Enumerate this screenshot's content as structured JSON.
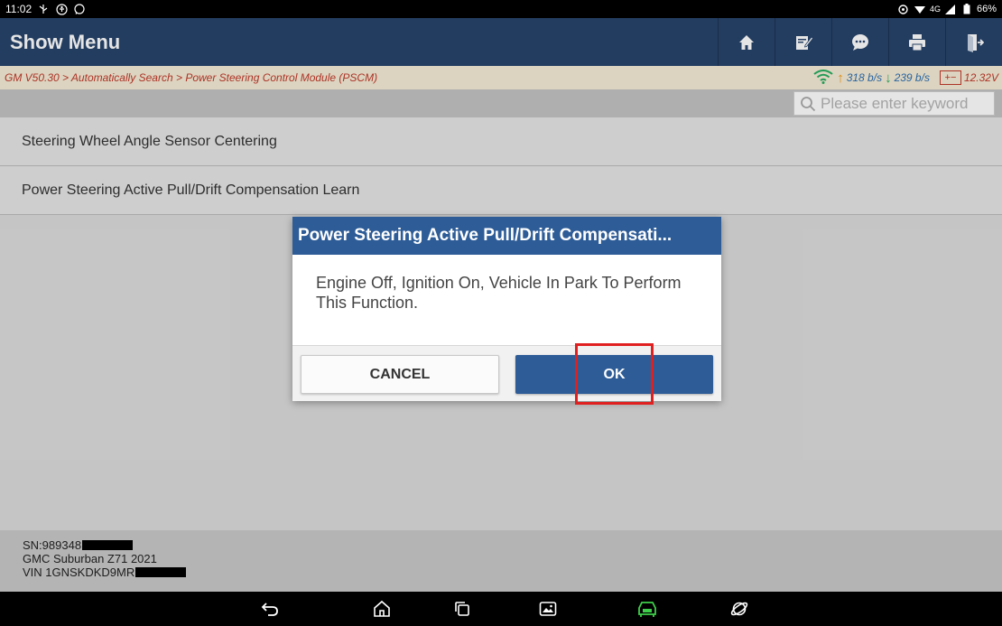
{
  "statusbar": {
    "time": "11:02",
    "network": "4G",
    "battery": "66%"
  },
  "header": {
    "title": "Show Menu",
    "actions": [
      "home-icon",
      "edit-icon",
      "chat-icon",
      "print-icon",
      "exit-icon"
    ]
  },
  "breadcrumb": {
    "path": "GM V50.30 > Automatically Search > Power Steering Control Module (PSCM)",
    "upload_rate": "318 b/s",
    "download_rate": "239 b/s",
    "voltage": "12.32V"
  },
  "search": {
    "placeholder": "Please enter keyword"
  },
  "menu": {
    "items": [
      {
        "label": "Steering Wheel Angle Sensor Centering"
      },
      {
        "label": "Power Steering Active Pull/Drift Compensation Learn"
      }
    ]
  },
  "dialog": {
    "title": "Power Steering Active Pull/Drift Compensati...",
    "message": "Engine Off, Ignition On, Vehicle In Park To Perform This Function.",
    "cancel_label": "CANCEL",
    "ok_label": "OK"
  },
  "vehicle": {
    "sn": "SN:989348",
    "model": "GMC Suburban Z71 2021",
    "vin": "VIN 1GNSKDKD9MR"
  },
  "colors": {
    "header": "#27446b",
    "dialog_title": "#2d5c97",
    "highlight": "#e02020"
  }
}
